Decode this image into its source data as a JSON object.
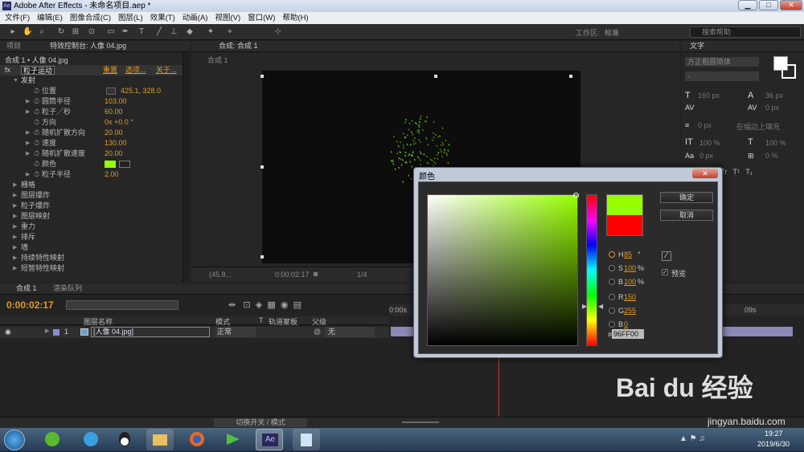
{
  "window": {
    "title": "Adobe After Effects - 未命名项目.aep *",
    "app_badge": "Ae",
    "minimize": "▁",
    "maximize": "□",
    "close": "✕"
  },
  "menu": [
    "文件(F)",
    "编辑(E)",
    "图像合成(C)",
    "图层(L)",
    "效果(T)",
    "动画(A)",
    "视图(V)",
    "窗口(W)",
    "帮助(H)"
  ],
  "toolbar": {
    "workspace_label": "工作区:",
    "workspace_value": "标准",
    "search_placeholder": "搜索帮助",
    "tools": [
      "▸",
      "✋",
      "⌕",
      "↻",
      "⊞",
      "⊙",
      "▭",
      "✒",
      "T",
      "╱",
      "⊥",
      "◆",
      "✦",
      "⌖",
      "⊹"
    ]
  },
  "effect_controls": {
    "tabs": [
      "项目",
      "特效控制台: 人像 04.jpg"
    ],
    "breadcrumb": "合成 1 • 人像 04.jpg",
    "effect": {
      "fx": "fx",
      "name": "粒子运动",
      "reset": "重置",
      "options": "选项...",
      "about": "关于..."
    },
    "section_emit": "发射",
    "properties": [
      {
        "label": "位置",
        "value": "425.1, 328.0"
      },
      {
        "label": "圆筒半径",
        "value": "103.00"
      },
      {
        "label": "粒子／秒",
        "value": "60.00"
      },
      {
        "label": "方向",
        "value": "0x +0.0 °"
      },
      {
        "label": "随机扩散方向",
        "value": "20.00"
      },
      {
        "label": "速度",
        "value": "130.00"
      },
      {
        "label": "随机扩散速度",
        "value": "20.00"
      },
      {
        "label": "颜色",
        "value": ""
      },
      {
        "label": "粒子半径",
        "value": "2.00"
      }
    ],
    "color_swatch": "#96FF00",
    "groups": [
      "栅格",
      "图层爆炸",
      "粒子爆炸",
      "图层映射",
      "重力",
      "排斥",
      "墙",
      "持续特性映射",
      "短暂特性映射"
    ]
  },
  "composition": {
    "tab": "合成: 合成 1",
    "sub_tab": "合成 1",
    "zoom": "(45.8...",
    "time": "0:00:02:17",
    "resolution": "1/4"
  },
  "character_panel": {
    "tab": "文字",
    "font": "方正粗圆简体",
    "font_style": "-",
    "size": "160 px",
    "leading": "36 px",
    "tracking": "0 px",
    "indent": "在幅边上填充",
    "scale_v": "100 %",
    "scale_h": "100 %",
    "baseline": "0 px",
    "tsume": "0 %",
    "style_buttons": [
      "T",
      "T",
      "TT",
      "Tr",
      "T¹",
      "T₁"
    ]
  },
  "timeline": {
    "tabs": [
      "合成 1",
      "渲染队列"
    ],
    "current_time": "0:00:02:17",
    "columns": [
      "图层名称",
      "模式",
      "T",
      "轨道蒙板",
      "父级"
    ],
    "layer": {
      "index": "1",
      "name": "[人像 04.jpg]",
      "mode": "正常",
      "parent": "无"
    },
    "ruler_start": "0:00s",
    "ruler_end": "09s",
    "bottom_label": "切换开关 / 模式"
  },
  "color_dialog": {
    "title": "颜色",
    "ok": "确定",
    "cancel": "取消",
    "preview": "预览",
    "fields": [
      {
        "label": "H",
        "value": "85",
        "unit": "°"
      },
      {
        "label": "S",
        "value": "100",
        "unit": "%"
      },
      {
        "label": "B",
        "value": "100",
        "unit": "%"
      },
      {
        "label": "R",
        "value": "150",
        "unit": ""
      },
      {
        "label": "G",
        "value": "255",
        "unit": ""
      },
      {
        "label": "B",
        "value": "0",
        "unit": ""
      }
    ],
    "hex_label": "#",
    "hex": "96FF00",
    "new_color": "#96FF00",
    "old_color": "#FF0000"
  },
  "taskbar": {
    "time": "19:27",
    "date": "2019/6/30",
    "ae_label": "Ae"
  },
  "watermark": {
    "brand": "Bai du 经验",
    "url": "jingyan.baidu.com"
  }
}
